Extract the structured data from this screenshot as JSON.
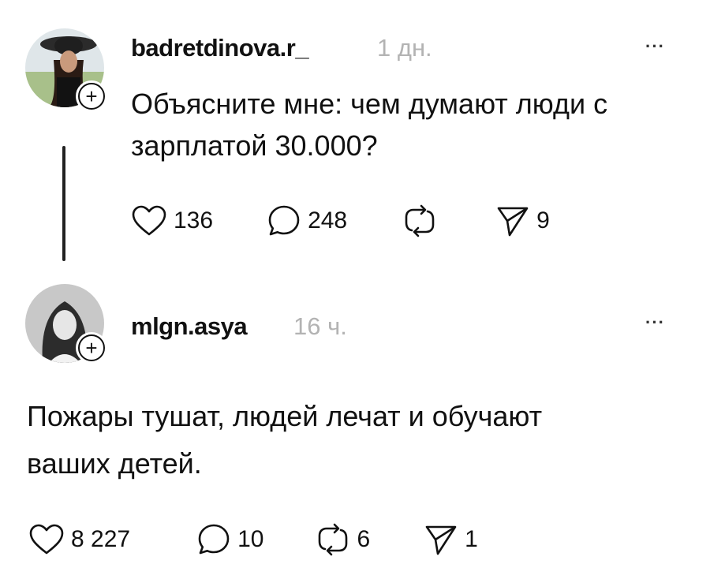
{
  "post1": {
    "username": "badretdinova.r_",
    "time": "1 дн.",
    "text": "Объясните мне: чем думают люди с зарплатой 30.000?",
    "text_line1": "Объясните мне: чем думают люди с",
    "text_line2": "зарплатой 30.000?",
    "likes": "136",
    "comments": "248",
    "shares": "9",
    "more_label": "···"
  },
  "post2": {
    "username": "mlgn.asya",
    "time": "16 ч.",
    "text_line1": "Пожары тушат, людей лечат и обучают",
    "text_line2": "ваших детей.",
    "likes": "8 227",
    "comments": "10",
    "reposts": "6",
    "shares": "1",
    "more_label": "···"
  },
  "icons": [
    "heart-icon",
    "comment-icon",
    "repost-icon",
    "send-icon",
    "plus-icon",
    "more-icon"
  ],
  "colors": {
    "text": "#111111",
    "muted": "#b3b3b3",
    "background": "#ffffff"
  }
}
